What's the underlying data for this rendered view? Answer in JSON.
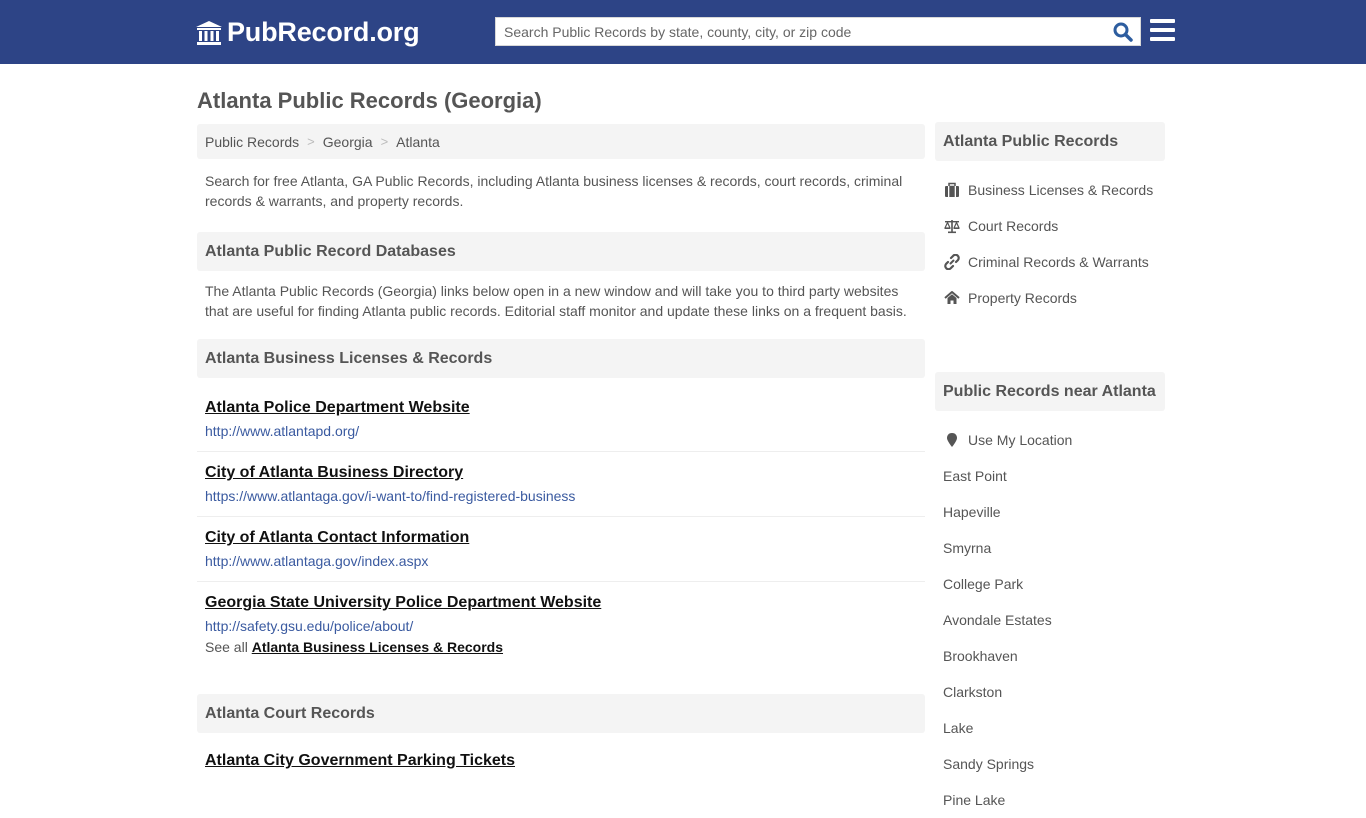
{
  "header": {
    "logo_text": "PubRecord.org",
    "search_placeholder": "Search Public Records by state, county, city, or zip code",
    "search_value": "",
    "brand_color": "#2d4486"
  },
  "page_title": "Atlanta Public Records (Georgia)",
  "breadcrumb": [
    {
      "label": "Public Records"
    },
    {
      "label": "Georgia"
    },
    {
      "label": "Atlanta"
    }
  ],
  "intro": "Search for free Atlanta, GA Public Records, including Atlanta business licenses & records, court records, criminal records & warrants, and property records.",
  "databases": {
    "header": "Atlanta Public Record Databases",
    "text": "The Atlanta Public Records (Georgia) links below open in a new window and will take you to third party websites that are useful for finding Atlanta public records. Editorial staff monitor and update these links on a frequent basis."
  },
  "business": {
    "header": "Atlanta Business Licenses & Records",
    "links": [
      {
        "title": "Atlanta Police Department Website",
        "url": "http://www.atlantapd.org/"
      },
      {
        "title": "City of Atlanta Business Directory",
        "url": "https://www.atlantaga.gov/i-want-to/find-registered-business"
      },
      {
        "title": "City of Atlanta Contact Information",
        "url": "http://www.atlantaga.gov/index.aspx"
      },
      {
        "title": "Georgia State University Police Department Website",
        "url": "http://safety.gsu.edu/police/about/"
      }
    ],
    "see_all_prefix": "See all",
    "see_all_link": "Atlanta Business Licenses & Records"
  },
  "court": {
    "header": "Atlanta Court Records",
    "links": [
      {
        "title": "Atlanta City Government Parking Tickets"
      }
    ]
  },
  "sidebar": {
    "records_header": "Atlanta Public Records",
    "records_items": [
      {
        "label": "Business Licenses & Records",
        "icon": "briefcase-icon"
      },
      {
        "label": "Court Records",
        "icon": "scale-icon"
      },
      {
        "label": "Criminal Records & Warrants",
        "icon": "link-icon"
      },
      {
        "label": "Property Records",
        "icon": "home-icon"
      }
    ],
    "nearby_header": "Public Records near Atlanta",
    "use_location": "Use My Location",
    "nearby_items": [
      "East Point",
      "Hapeville",
      "Smyrna",
      "College Park",
      "Avondale Estates",
      "Brookhaven",
      "Clarkston",
      "Lake",
      "Sandy Springs",
      "Pine Lake"
    ]
  }
}
